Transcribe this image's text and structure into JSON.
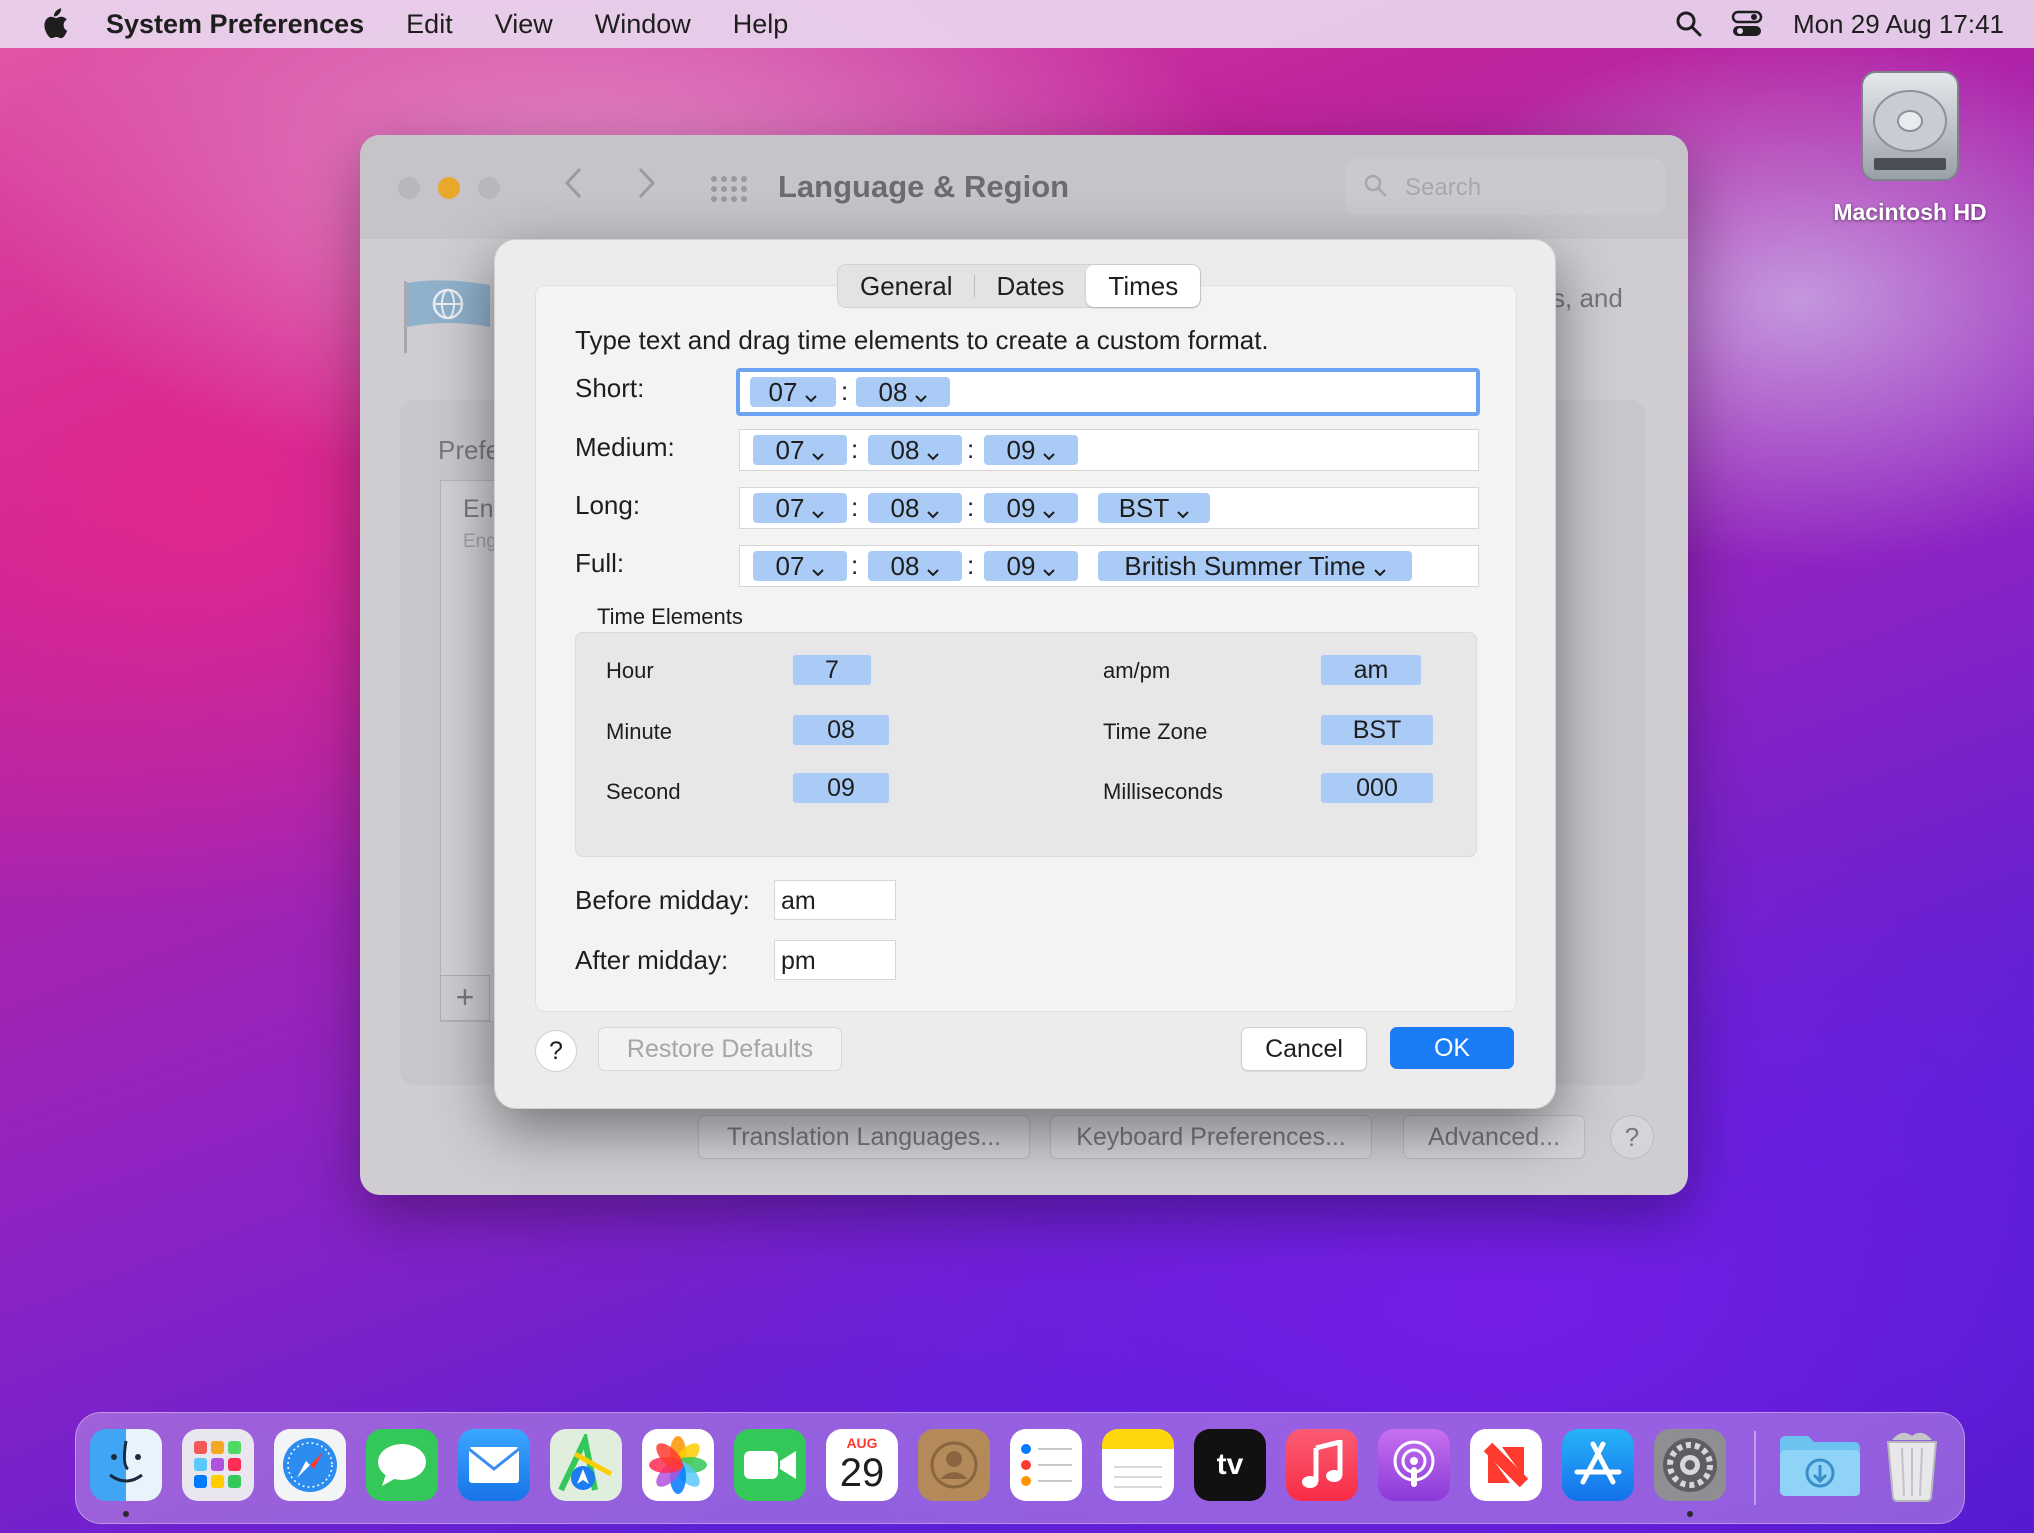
{
  "menubar": {
    "app_name": "System Preferences",
    "items": [
      "Edit",
      "View",
      "Window",
      "Help"
    ],
    "clock": "Mon 29 Aug  17:41"
  },
  "desktop": {
    "drive_label": "Macintosh HD"
  },
  "window": {
    "title": "Language & Region",
    "search_placeholder": "Search",
    "partial_text": "s, and",
    "pref_label": "Prefe",
    "lang_primary": "En",
    "lang_secondary": "Eng",
    "add_label": "+",
    "buttons": {
      "translation": "Translation Languages...",
      "keyboard": "Keyboard Preferences...",
      "advanced": "Advanced...",
      "help": "?"
    }
  },
  "sheet": {
    "tabs": [
      "General",
      "Dates",
      "Times"
    ],
    "active_tab": "Times",
    "instruction": "Type text and drag time elements to create a custom format.",
    "formats": {
      "short": {
        "label": "Short:",
        "hour": "07",
        "minute": "08"
      },
      "medium": {
        "label": "Medium:",
        "hour": "07",
        "minute": "08",
        "second": "09"
      },
      "long": {
        "label": "Long:",
        "hour": "07",
        "minute": "08",
        "second": "09",
        "zone": "BST"
      },
      "full": {
        "label": "Full:",
        "hour": "07",
        "minute": "08",
        "second": "09",
        "zone": "British Summer Time"
      },
      "separator": ":"
    },
    "time_elements": {
      "title": "Time Elements",
      "hour_label": "Hour",
      "hour_value": "7",
      "minute_label": "Minute",
      "minute_value": "08",
      "second_label": "Second",
      "second_value": "09",
      "ampm_label": "am/pm",
      "ampm_value": "am",
      "tz_label": "Time Zone",
      "tz_value": "BST",
      "ms_label": "Milliseconds",
      "ms_value": "000"
    },
    "before_midday_label": "Before midday:",
    "before_midday_value": "am",
    "after_midday_label": "After midday:",
    "after_midday_value": "pm",
    "help": "?",
    "restore_defaults": "Restore Defaults",
    "cancel": "Cancel",
    "ok": "OK"
  },
  "dock": {
    "calendar_month": "AUG",
    "calendar_day": "29",
    "apps": [
      "finder",
      "launchpad",
      "safari",
      "messages",
      "mail",
      "maps",
      "photos",
      "facetime",
      "calendar",
      "contacts",
      "reminders",
      "notes",
      "tv",
      "music",
      "podcasts",
      "news",
      "app-store",
      "system-preferences",
      "downloads",
      "trash"
    ],
    "tv_label": "tv"
  },
  "colors": {
    "accent": "#1a7cf5",
    "token": "#a9cbf5",
    "focus_ring": "#6ea2f2"
  }
}
